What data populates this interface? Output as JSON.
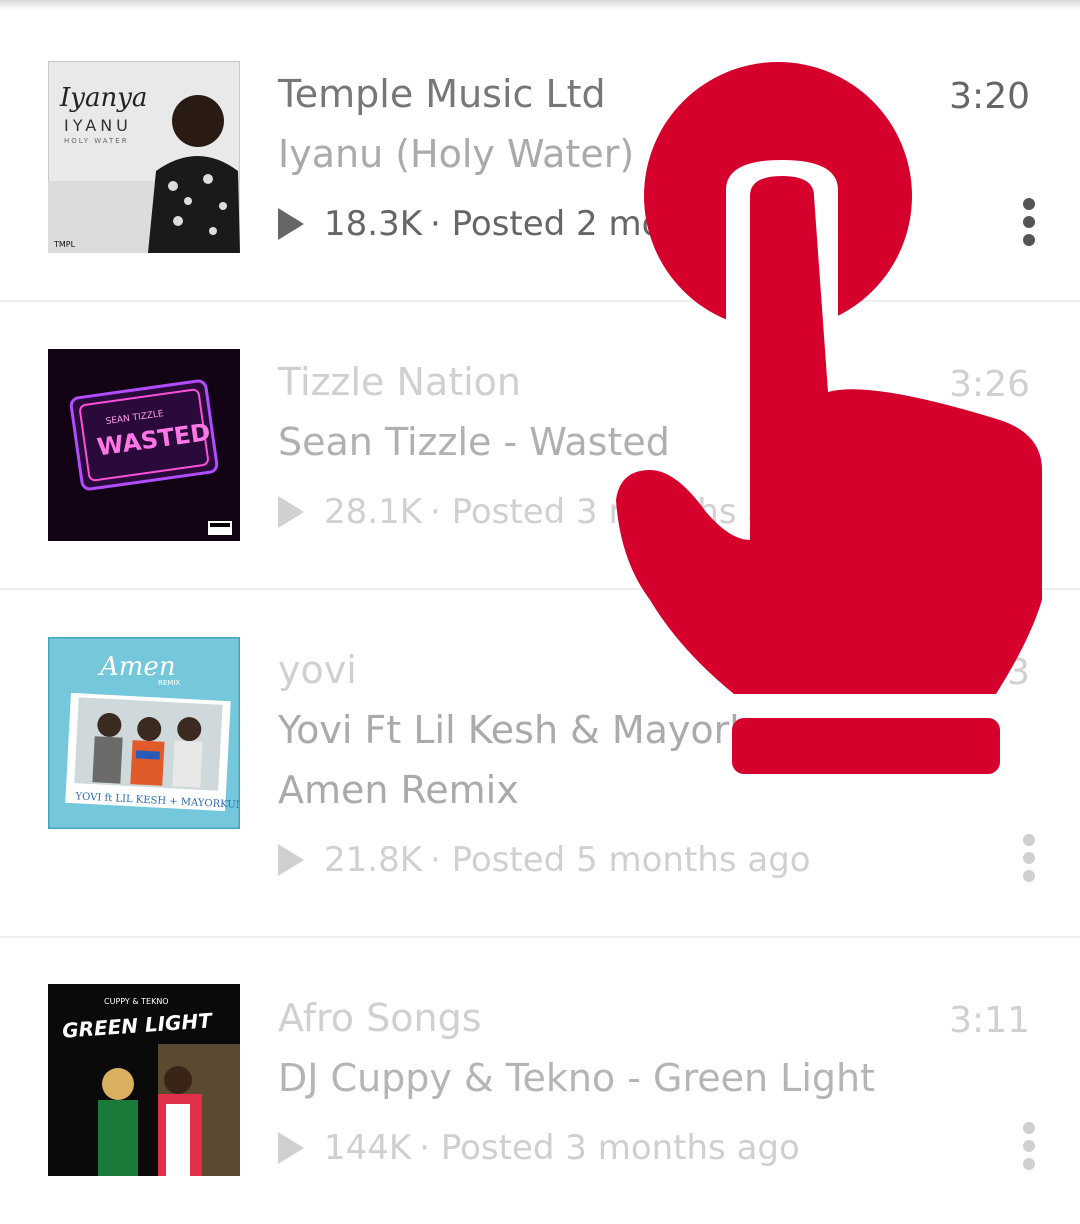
{
  "tracks": [
    {
      "artist": "Temple Music Ltd",
      "title": "Iyanu  (Holy Water)",
      "duration": "3:20",
      "plays": "18.3K",
      "posted": "· Posted 2 months ago",
      "art": {
        "text_main": "Iyanya",
        "text_sub": "IYANU",
        "text_sub2": "HOLY WATER",
        "label": "TMPL"
      }
    },
    {
      "artist": "Tizzle Nation",
      "title": "Sean Tizzle - Wasted",
      "duration": "3:26",
      "plays": "28.1K",
      "posted": "· Posted 3 months ago",
      "art": {
        "text_main": "WASTED",
        "text_sub": "SEAN TIZZLE"
      }
    },
    {
      "artist": "yovi",
      "title": "Yovi Ft Lil Kesh & Mayorkun - Amen Remix",
      "duration": "3:33",
      "plays": "21.8K",
      "posted": "· Posted 5 months ago",
      "art": {
        "text_main": "Amen",
        "text_sub": "REMIX",
        "text_bottom": "YOVI ft LIL KESH + MAYORKUN"
      }
    },
    {
      "artist": "Afro Songs",
      "title": "DJ Cuppy & Tekno - Green Light",
      "duration": "3:11",
      "plays": "144K",
      "posted": "· Posted 3 months ago",
      "art": {
        "text_main": "GREEN LIGHT",
        "text_sub": "CUPPY & TEKNO"
      }
    }
  ],
  "colors": {
    "tap_overlay": "#d5002b",
    "text_dark": "#666666",
    "text_faded": "#d0d0d0"
  },
  "icons": {
    "play": "play-icon",
    "more": "more-vertical-icon",
    "tap": "tap-hand-icon"
  }
}
